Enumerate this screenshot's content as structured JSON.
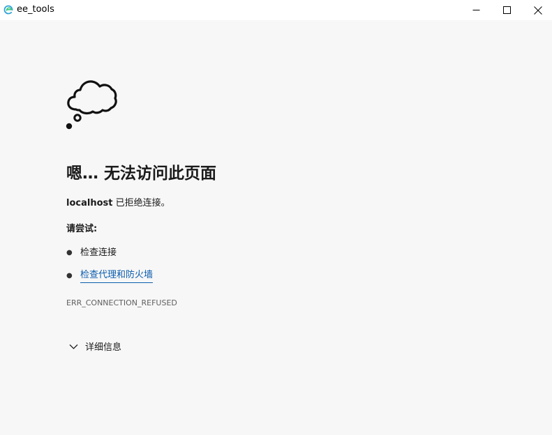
{
  "window": {
    "title": "ee_tools",
    "icon": "edge-webview-icon",
    "controls": [
      "minimize-icon",
      "maximize-icon",
      "close-icon"
    ]
  },
  "error_page": {
    "icon": "thought-cloud-icon",
    "heading": "嗯… 无法访问此页面",
    "host": "localhost",
    "message_suffix": " 已拒绝连接。",
    "try_label": "请尝试:",
    "suggestions": [
      {
        "label": "检查连接",
        "is_link": false
      },
      {
        "label": "检查代理和防火墙",
        "is_link": true
      }
    ],
    "error_code": "ERR_CONNECTION_REFUSED",
    "details_label": "详细信息"
  },
  "colors": {
    "background": "#f7f7f7",
    "titlebar": "#ffffff",
    "link": "#0b5cad",
    "error_code": "#5f5f5f"
  }
}
